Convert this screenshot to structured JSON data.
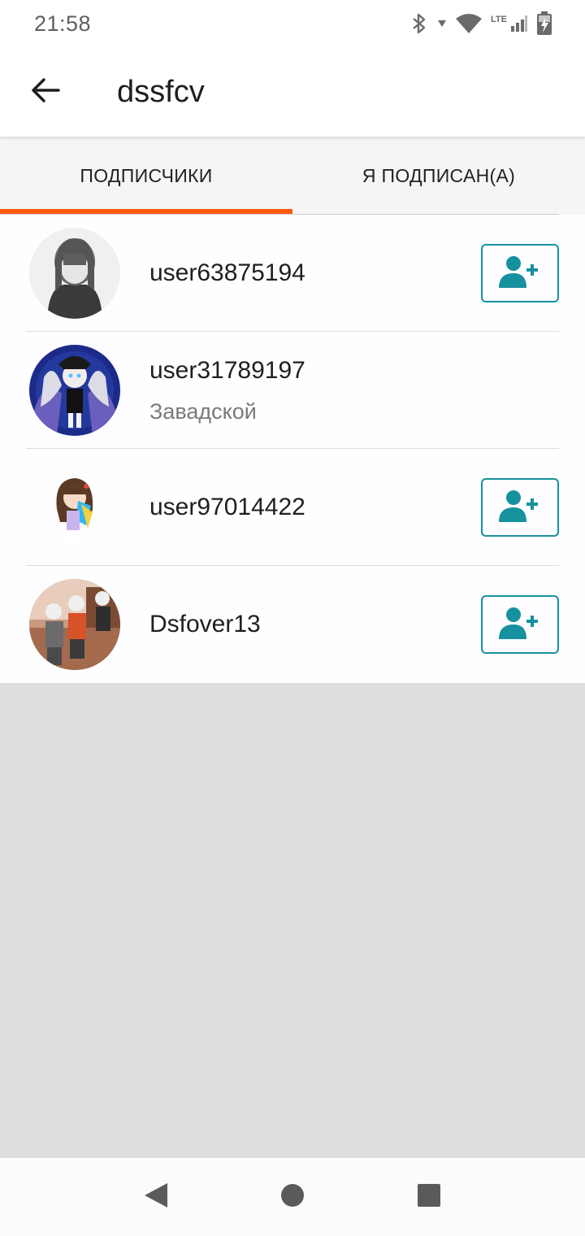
{
  "status_bar": {
    "time": "21:58",
    "network_label": "LTE",
    "icons": [
      "bluetooth-icon",
      "wifi-icon",
      "cell-signal-icon",
      "battery-charging-icon"
    ]
  },
  "app_bar": {
    "title": "dssfcv",
    "back_icon": "arrow-back-icon"
  },
  "tabs": [
    {
      "label": "ПОДПИСЧИКИ",
      "active": true
    },
    {
      "label": "Я ПОДПИСАН(А)",
      "active": false
    }
  ],
  "followers": [
    {
      "username": "user63875194",
      "subtitle": "",
      "follow_button": true
    },
    {
      "username": "user31789197",
      "subtitle": "Завадской",
      "follow_button": false
    },
    {
      "username": "user97014422",
      "subtitle": "",
      "follow_button": true
    },
    {
      "username": "Dsfover13",
      "subtitle": "",
      "follow_button": true
    }
  ],
  "colors": {
    "accent": "#ff5a10",
    "follow_button": "#16919e",
    "tab_bg": "#f5f4f6",
    "empty_bg": "#dfdde0"
  },
  "nav_bar": {
    "icons": [
      "nav-back-icon",
      "nav-home-icon",
      "nav-recents-icon"
    ]
  }
}
